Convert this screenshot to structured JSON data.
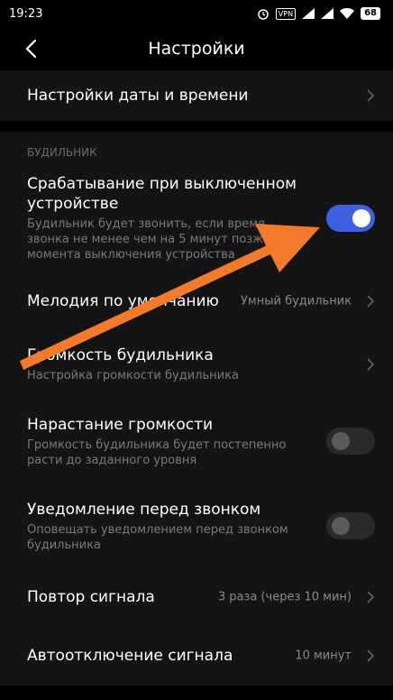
{
  "status_bar": {
    "time": "19:23",
    "vpn": "VPN",
    "battery": "68"
  },
  "header": {
    "title": "Настройки"
  },
  "date_time": {
    "label": "Настройки даты и времени"
  },
  "section": {
    "label": "БУДИЛЬНИК"
  },
  "rows": {
    "power_off": {
      "title": "Срабатывание при выключенном устройстве",
      "subtitle": "Будильник будет звонить, если время звонка не менее чем на 5 минут позже момента выключения устройства",
      "enabled": true
    },
    "melody": {
      "title": "Мелодия по умолчанию",
      "value": "Умный будильник"
    },
    "volume": {
      "title": "Громкость будильника",
      "subtitle": "Настройка громкости будильника"
    },
    "rising": {
      "title": "Нарастание громкости",
      "subtitle": "Громкость будильника будет постепенно расти до заданного уровня",
      "enabled": false
    },
    "notify": {
      "title": "Уведомление перед звонком",
      "subtitle": "Оповещать уведомлением перед звонком будильника",
      "enabled": false
    },
    "repeat": {
      "title": "Повтор сигнала",
      "value": "3 раза (через 10 мин)"
    },
    "autooff": {
      "title": "Автоотключение сигнала",
      "value": "10 минут"
    }
  },
  "colors": {
    "toggle_on": "#3d5fe0",
    "annotation_arrow": "#f27a2a"
  }
}
